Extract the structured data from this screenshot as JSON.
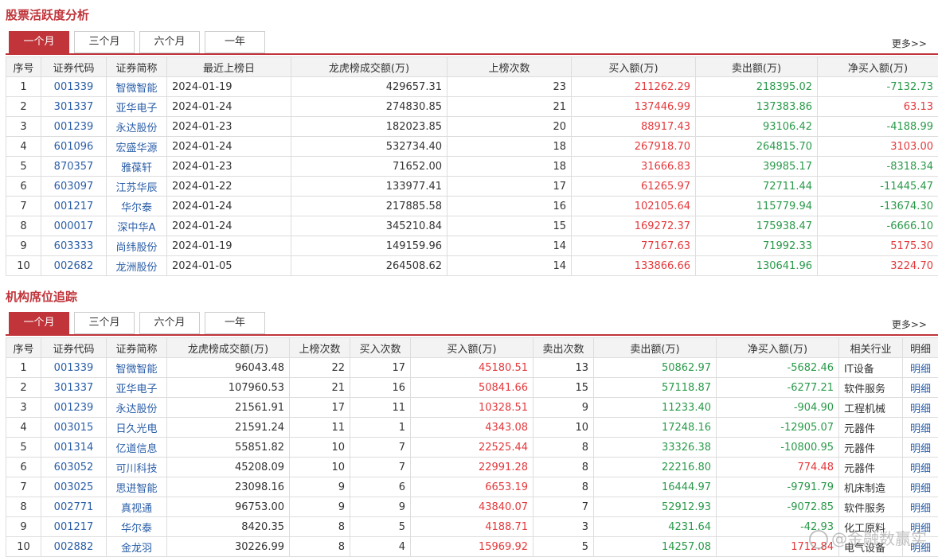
{
  "section1": {
    "title": "股票活跃度分析",
    "tabs": [
      "一个月",
      "三个月",
      "六个月",
      "一年"
    ],
    "more": "更多>>",
    "headers": [
      "序号",
      "证券代码",
      "证券简称",
      "最近上榜日",
      "龙虎榜成交额(万)",
      "上榜次数",
      "买入额(万)",
      "卖出额(万)",
      "净买入额(万)"
    ],
    "rows": [
      [
        "1",
        "001339",
        "智微智能",
        "2024-01-19",
        "429657.31",
        "23",
        "211262.29",
        "218395.02",
        "-7132.73"
      ],
      [
        "2",
        "301337",
        "亚华电子",
        "2024-01-24",
        "274830.85",
        "21",
        "137446.99",
        "137383.86",
        "63.13"
      ],
      [
        "3",
        "001239",
        "永达股份",
        "2024-01-23",
        "182023.85",
        "20",
        "88917.43",
        "93106.42",
        "-4188.99"
      ],
      [
        "4",
        "601096",
        "宏盛华源",
        "2024-01-24",
        "532734.40",
        "18",
        "267918.70",
        "264815.70",
        "3103.00"
      ],
      [
        "5",
        "870357",
        "雅葆轩",
        "2024-01-23",
        "71652.00",
        "18",
        "31666.83",
        "39985.17",
        "-8318.34"
      ],
      [
        "6",
        "603097",
        "江苏华辰",
        "2024-01-22",
        "133977.41",
        "17",
        "61265.97",
        "72711.44",
        "-11445.47"
      ],
      [
        "7",
        "001217",
        "华尔泰",
        "2024-01-24",
        "217885.58",
        "16",
        "102105.64",
        "115779.94",
        "-13674.30"
      ],
      [
        "8",
        "000017",
        "深中华A",
        "2024-01-24",
        "345210.84",
        "15",
        "169272.37",
        "175938.47",
        "-6666.10"
      ],
      [
        "9",
        "603333",
        "尚纬股份",
        "2024-01-19",
        "149159.96",
        "14",
        "77167.63",
        "71992.33",
        "5175.30"
      ],
      [
        "10",
        "002682",
        "龙洲股份",
        "2024-01-05",
        "264508.62",
        "14",
        "133866.66",
        "130641.96",
        "3224.70"
      ]
    ]
  },
  "section2": {
    "title": "机构席位追踪",
    "tabs": [
      "一个月",
      "三个月",
      "六个月",
      "一年"
    ],
    "more": "更多>>",
    "headers": [
      "序号",
      "证券代码",
      "证券简称",
      "龙虎榜成交额(万)",
      "上榜次数",
      "买入次数",
      "买入额(万)",
      "卖出次数",
      "卖出额(万)",
      "净买入额(万)",
      "相关行业",
      "明细"
    ],
    "rows": [
      [
        "1",
        "001339",
        "智微智能",
        "96043.48",
        "22",
        "17",
        "45180.51",
        "13",
        "50862.97",
        "-5682.46",
        "IT设备",
        "明细"
      ],
      [
        "2",
        "301337",
        "亚华电子",
        "107960.53",
        "21",
        "16",
        "50841.66",
        "15",
        "57118.87",
        "-6277.21",
        "软件服务",
        "明细"
      ],
      [
        "3",
        "001239",
        "永达股份",
        "21561.91",
        "17",
        "11",
        "10328.51",
        "9",
        "11233.40",
        "-904.90",
        "工程机械",
        "明细"
      ],
      [
        "4",
        "003015",
        "日久光电",
        "21591.24",
        "11",
        "1",
        "4343.08",
        "10",
        "17248.16",
        "-12905.07",
        "元器件",
        "明细"
      ],
      [
        "5",
        "001314",
        "亿道信息",
        "55851.82",
        "10",
        "7",
        "22525.44",
        "8",
        "33326.38",
        "-10800.95",
        "元器件",
        "明细"
      ],
      [
        "6",
        "603052",
        "可川科技",
        "45208.09",
        "10",
        "7",
        "22991.28",
        "8",
        "22216.80",
        "774.48",
        "元器件",
        "明细"
      ],
      [
        "7",
        "003025",
        "思进智能",
        "23098.16",
        "9",
        "6",
        "6653.19",
        "8",
        "16444.97",
        "-9791.79",
        "机床制造",
        "明细"
      ],
      [
        "8",
        "002771",
        "真视通",
        "96753.00",
        "9",
        "9",
        "43840.07",
        "7",
        "52912.93",
        "-9072.85",
        "软件服务",
        "明细"
      ],
      [
        "9",
        "001217",
        "华尔泰",
        "8420.35",
        "8",
        "5",
        "4188.71",
        "3",
        "4231.64",
        "-42.93",
        "化工原料",
        "明细"
      ],
      [
        "10",
        "002882",
        "金龙羽",
        "30226.99",
        "8",
        "4",
        "15969.92",
        "5",
        "14257.08",
        "1712.84",
        "电气设备",
        "明细"
      ]
    ]
  },
  "watermark": "@金融数赢实",
  "colors": {
    "accent": "#c0343a",
    "up": "#e4393c",
    "down": "#2a9a4a",
    "link": "#2a5ea8"
  }
}
